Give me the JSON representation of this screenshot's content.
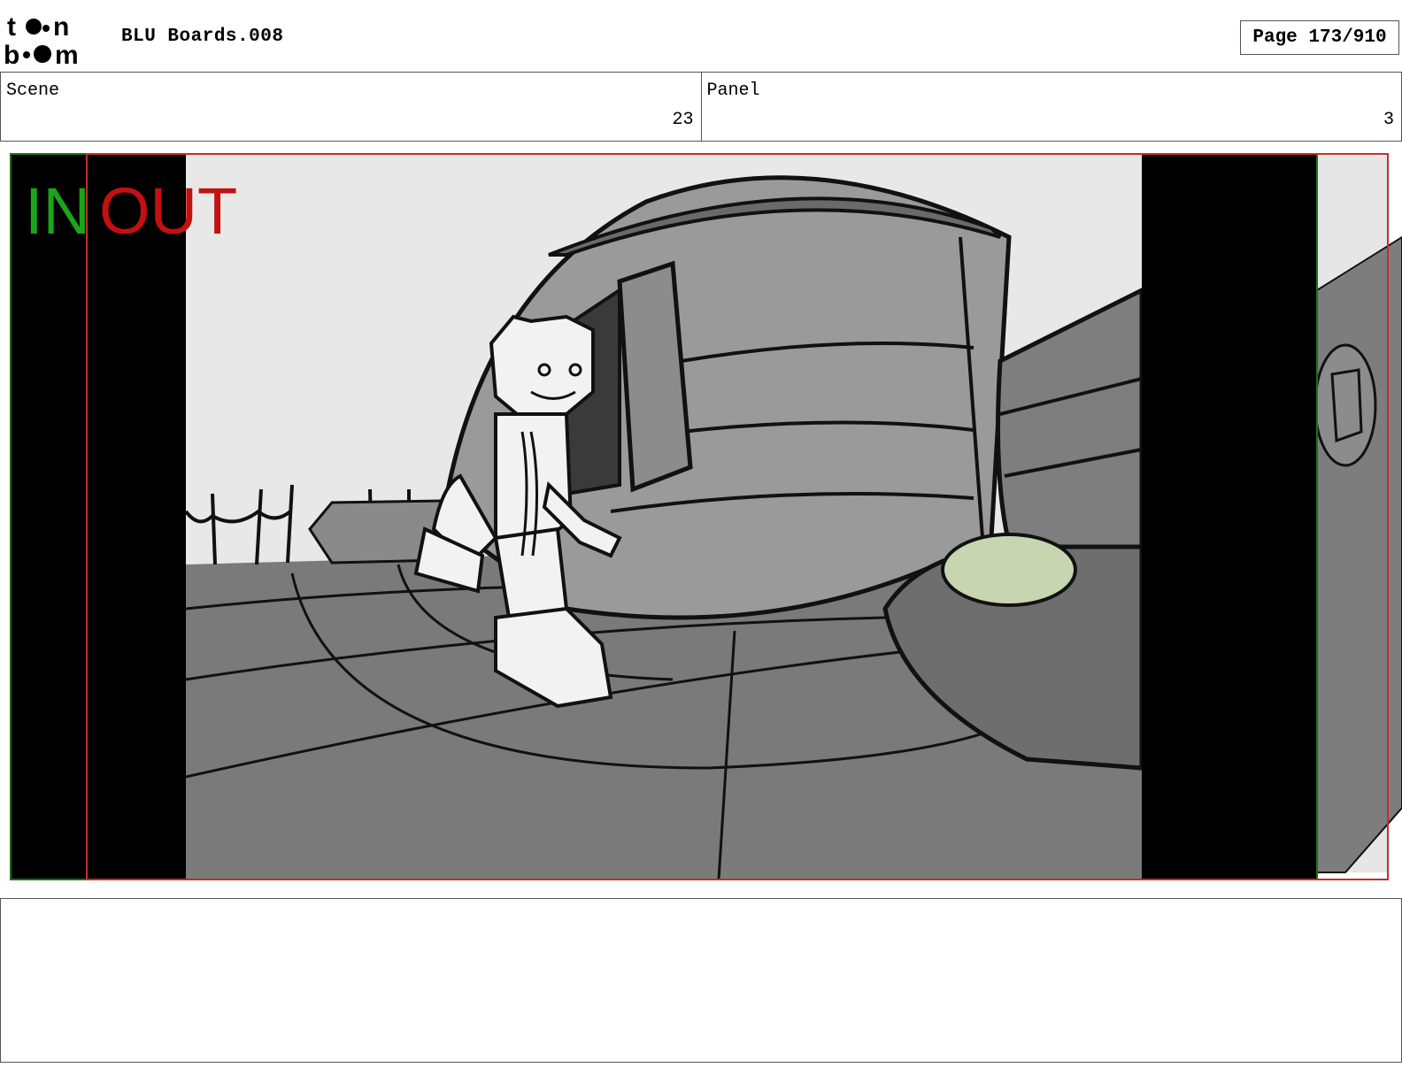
{
  "header": {
    "logo_text": "toon boom",
    "title": "BLU Boards.008",
    "page": "Page 173/910"
  },
  "info": {
    "scene_label": "Scene",
    "scene_value": "23",
    "panel_label": "Panel",
    "panel_value": "3"
  },
  "frame": {
    "in_label": "IN",
    "out_label": "OUT",
    "colors": {
      "in": "#1aa51a",
      "out": "#c41010",
      "in_frame": "#1f6f1f",
      "out_frame": "#c03030"
    }
  },
  "notes": {
    "text": ""
  }
}
